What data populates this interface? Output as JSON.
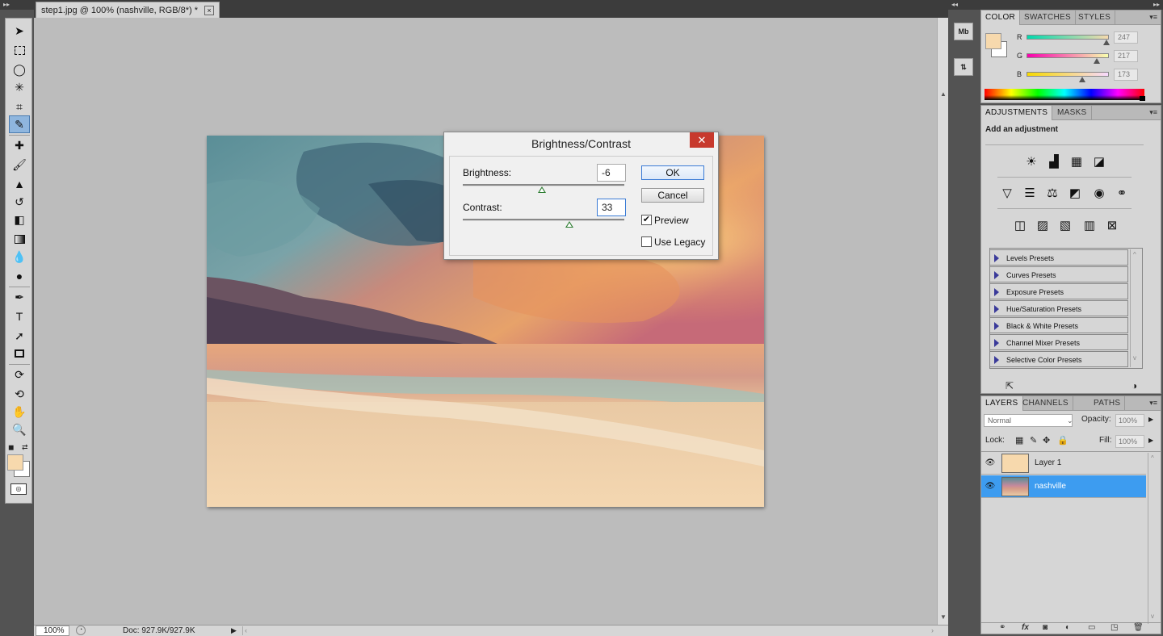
{
  "document": {
    "tab_title": "step1.jpg @ 100% (nashville, RGB/8*) *",
    "close_glyph": "×",
    "zoom": "100%",
    "doc_info": "Doc: 927.9K/927.9K"
  },
  "dialog": {
    "title": "Brightness/Contrast",
    "close_glyph": "✕",
    "brightness_label": "Brightness:",
    "brightness_value": "-6",
    "brightness_level": 0.49,
    "contrast_label": "Contrast:",
    "contrast_value": "33",
    "contrast_level": 0.66,
    "ok_label": "OK",
    "cancel_label": "Cancel",
    "preview_label": "Preview",
    "preview_checked": true,
    "legacy_label": "Use Legacy",
    "legacy_checked": false
  },
  "color_panel": {
    "tabs": [
      "COLOR",
      "SWATCHES",
      "STYLES"
    ],
    "r_label": "R",
    "g_label": "G",
    "b_label": "B",
    "r_value": "247",
    "g_value": "217",
    "b_value": "173",
    "foreground": "#f7d9ad",
    "background": "#ffffff"
  },
  "adjustments_panel": {
    "tabs": [
      "ADJUSTMENTS",
      "MASKS"
    ],
    "heading": "Add an adjustment",
    "presets": [
      "Levels Presets",
      "Curves Presets",
      "Exposure Presets",
      "Hue/Saturation Presets",
      "Black & White Presets",
      "Channel Mixer Presets",
      "Selective Color Presets"
    ]
  },
  "layers_panel": {
    "tabs": [
      "LAYERS",
      "CHANNELS",
      "PATHS"
    ],
    "blend_mode": "Normal",
    "opacity_label": "Opacity:",
    "opacity_value": "100%",
    "lock_label": "Lock:",
    "fill_label": "Fill:",
    "fill_value": "100%",
    "layers": [
      {
        "name": "Layer 1",
        "thumb_color": "#f7d9ad",
        "selected": false
      },
      {
        "name": "nashville",
        "thumb_color": "photo",
        "selected": true
      }
    ]
  },
  "tools": [
    "move-tool",
    "marquee-tool",
    "lasso-tool",
    "magic-wand-tool",
    "crop-tool",
    "eyedropper-tool",
    "healing-brush-tool",
    "brush-tool",
    "clone-stamp-tool",
    "history-brush-tool",
    "eraser-tool",
    "gradient-tool",
    "blur-tool",
    "dodge-tool",
    "pen-tool",
    "type-tool",
    "path-selection-tool",
    "shape-tool",
    "3d-rotate-tool",
    "3d-orbit-tool",
    "hand-tool",
    "zoom-tool"
  ],
  "toolbox_colors": {
    "foreground": "#f7d9ad",
    "background": "#ffffff"
  }
}
